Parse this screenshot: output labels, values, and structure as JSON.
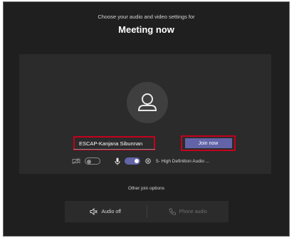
{
  "header": {
    "subtitle": "Choose your audio and video settings for",
    "title": "Meeting now"
  },
  "prejoin": {
    "name_value": "ESCAP-Kanjana Sibunnan",
    "join_label": "Join now",
    "video_toggle": "off",
    "mic_toggle": "on",
    "audio_device": "5- High Definition Audio ..."
  },
  "other_join": {
    "heading": "Other join options",
    "audio_off_label": "Audio off",
    "phone_audio_label": "Phone audio"
  },
  "colors": {
    "background": "#1f1f1f",
    "panel": "#2b2b2b",
    "accent": "#6264a7",
    "highlight_border": "#c4001e"
  }
}
